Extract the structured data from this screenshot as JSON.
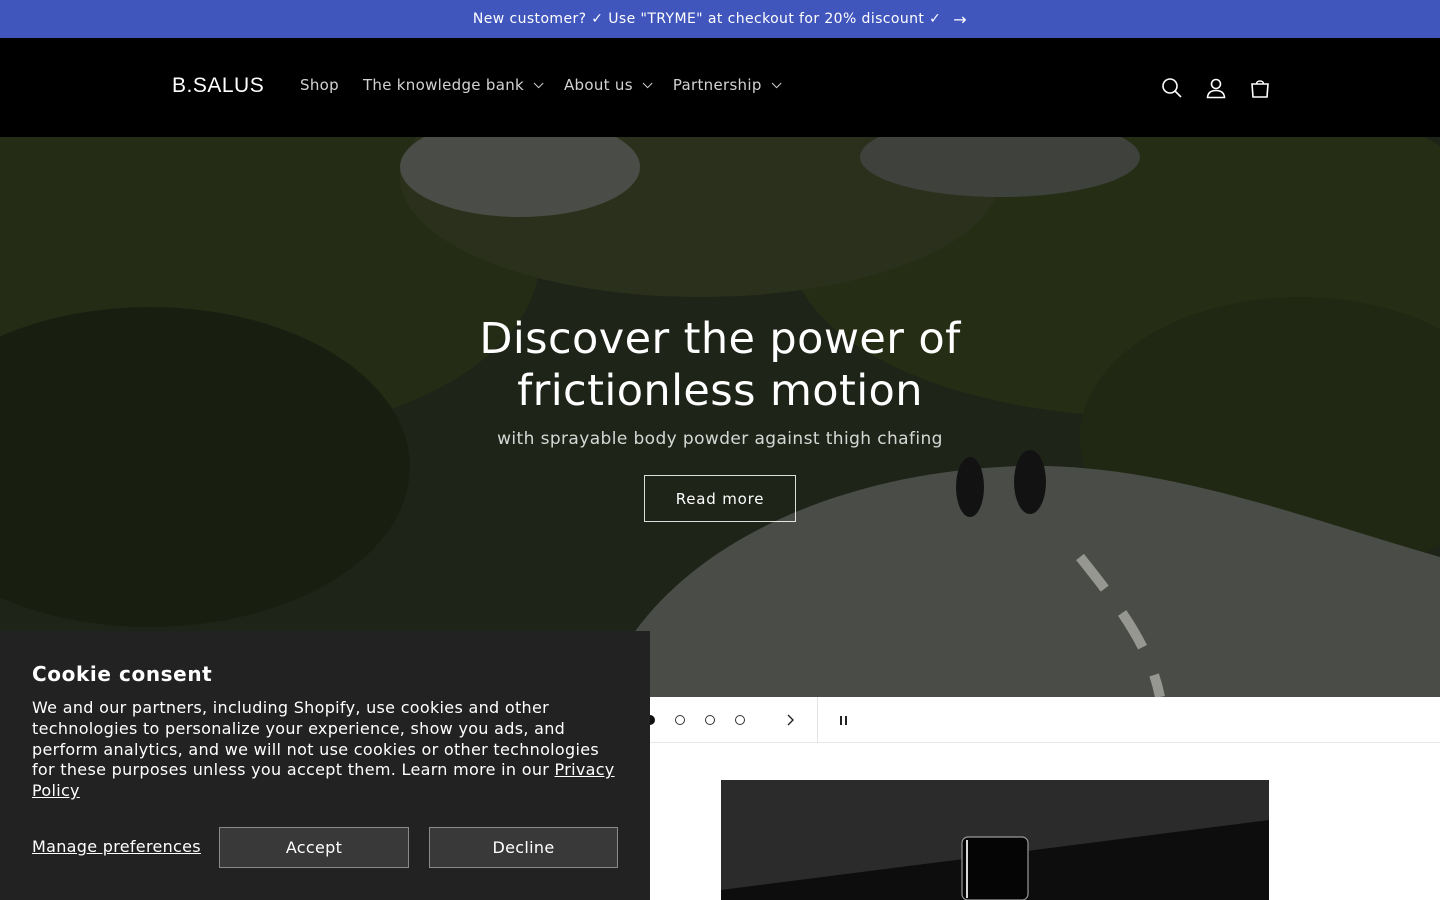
{
  "announcement": {
    "text": "New customer? ✓ Use \"TRYME\" at checkout for 20% discount ✓",
    "arrow": "→"
  },
  "header": {
    "logo": "B.SALUS",
    "nav": [
      {
        "label": "Shop",
        "has_dropdown": false
      },
      {
        "label": "The knowledge bank",
        "has_dropdown": true
      },
      {
        "label": "About us",
        "has_dropdown": true
      },
      {
        "label": "Partnership",
        "has_dropdown": true
      }
    ],
    "icons": [
      "search-icon",
      "account-icon",
      "cart-icon"
    ]
  },
  "hero": {
    "title": "Discover the power of frictionless motion",
    "subtitle": "with sprayable body powder against thigh chafing",
    "button_label": "Read more"
  },
  "slider": {
    "slides": 4,
    "active_index": 0
  },
  "cookie": {
    "title": "Cookie consent",
    "body": "We and our partners, including Shopify, use cookies and other technologies to personalize your experience, show you ads, and perform analytics, and we will not use cookies or other technologies for these purposes unless you accept them. Learn more in our ",
    "link": "Privacy Policy",
    "manage_label": "Manage preferences",
    "accept_label": "Accept",
    "decline_label": "Decline"
  },
  "colors": {
    "announcement_bg": "#4056bd",
    "header_bg": "#000000",
    "cookie_bg": "#232223"
  }
}
